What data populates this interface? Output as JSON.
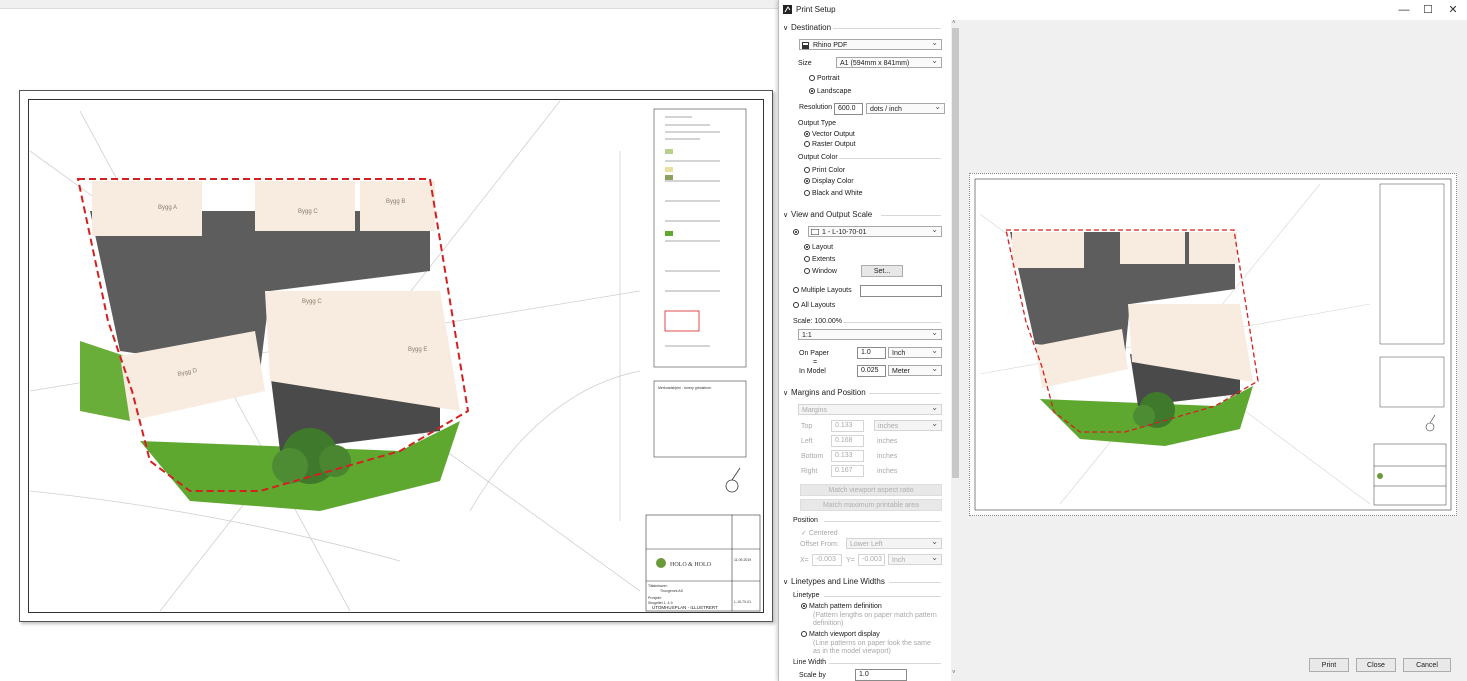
{
  "dialog": {
    "title": "Print Setup",
    "window_controls": {
      "minimize": "—",
      "maximize": "☐",
      "close": "✕"
    }
  },
  "destination": {
    "header": "Destination",
    "printer": "Rhino PDF",
    "size_label": "Size",
    "size_value": "A1 (594mm x 841mm)",
    "portrait": "Portrait",
    "landscape": "Landscape",
    "resolution_label": "Resolution",
    "resolution_value": "600.0",
    "resolution_unit": "dots / inch",
    "output_type_label": "Output Type",
    "vector_output": "Vector Output",
    "raster_output": "Raster Output",
    "output_color_label": "Output Color",
    "print_color": "Print Color",
    "display_color": "Display Color",
    "black_white": "Black and White"
  },
  "view_scale": {
    "header": "View and Output Scale",
    "layout_select": "1 - L-10-70-01",
    "layout": "Layout",
    "extents": "Extents",
    "window": "Window",
    "set_button": "Set...",
    "multiple_layouts": "Multiple Layouts",
    "all_layouts": "All Layouts",
    "scale_label": "Scale: 100.00%",
    "scale_select": "1:1",
    "on_paper_label": "On Paper",
    "on_paper_value": "1.0",
    "on_paper_unit": "Inch",
    "equals": "=",
    "in_model_label": "In Model",
    "in_model_value": "0.025",
    "in_model_unit": "Meter"
  },
  "margins": {
    "header": "Margins and Position",
    "margins_select": "Margins",
    "top_label": "Top",
    "top_value": "0.133",
    "top_unit": "inches",
    "left_label": "Left",
    "left_value": "0.168",
    "left_unit": "inches",
    "bottom_label": "Bottom",
    "bottom_value": "0.133",
    "bottom_unit": "inches",
    "right_label": "Right",
    "right_value": "0.167",
    "right_unit": "inches",
    "match_aspect": "Match viewport aspect ratio",
    "match_printable": "Match maximum printable area",
    "position_label": "Position",
    "centered": "Centered",
    "offset_from_label": "Offset From:",
    "offset_from_value": "Lower Left",
    "x_label": "X=",
    "x_value": "-0.003",
    "y_label": "Y=",
    "y_value": "-0.003",
    "offset_unit": "Inch"
  },
  "linetypes": {
    "header": "Linetypes and Line Widths",
    "linetype_label": "Linetype",
    "match_pattern": "Match pattern definition",
    "match_pattern_desc": "(Pattern lengths on paper match pattern definition)",
    "match_viewport": "Match viewport display",
    "match_viewport_desc": "(Line patterns on paper look the same as in the model viewport)",
    "line_width_label": "Line Width",
    "scale_by_label": "Scale by",
    "scale_by_value": "1.0"
  },
  "footer": {
    "print": "Print",
    "close": "Close",
    "cancel": "Cancel"
  },
  "drawing": {
    "buildings": [
      "Bygg A",
      "Bygg C",
      "Bygg B",
      "Bygg C",
      "Bygg E",
      "Bygg D"
    ],
    "company": "HOLO & HOLO",
    "sheet_title": "UTOMHUSPLAN - ILLUSTRERT",
    "project_label": "Tiltakshaver:",
    "project_value": "Thungenes AS",
    "phase_label": "Prosjekt:",
    "phase_value": "Skogetlet 1, 4-9",
    "title_label": "Tittel:",
    "date_value": "11.09.2019",
    "drawing_number": "L-10-70-01",
    "revision_label": "Rev",
    "notes_heading": "Merknadshjem - tonery grindstrom"
  },
  "colors": {
    "accent_red": "#d42020",
    "lawn": "#5fa830",
    "building": "#f8ece0",
    "road": "#5d5d5d"
  }
}
